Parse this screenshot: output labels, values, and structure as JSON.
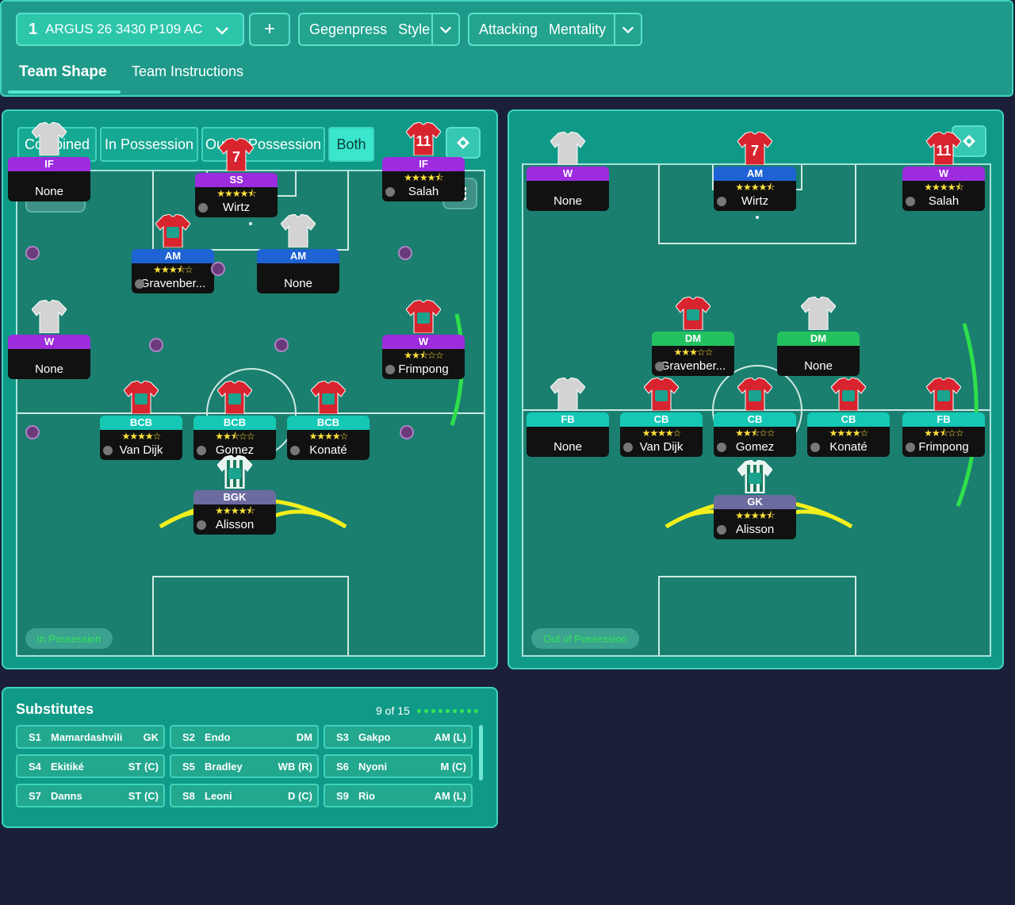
{
  "topbar": {
    "tactic_number": "1",
    "tactic_name": "ARGUS 26 3430 P109 AC",
    "add_label": "+",
    "style_value": "Gegenpress",
    "style_label": "Style",
    "mentality_value": "Attacking",
    "mentality_label": "Mentality",
    "tabs": [
      "Team Shape",
      "Team Instructions"
    ]
  },
  "left_panel": {
    "segments": [
      "Combined",
      "In Possession",
      "Out of Possession",
      "Both"
    ],
    "phase_label": "In Possession",
    "players": [
      {
        "role": "IF",
        "stars": "",
        "name": "None",
        "number": ""
      },
      {
        "role": "SS",
        "stars": "★★★★⯪",
        "name": "Wirtz",
        "number": "7"
      },
      {
        "role": "IF",
        "stars": "★★★★⯪",
        "name": "Salah",
        "number": "11"
      },
      {
        "role": "AM",
        "stars": "★★★⯪☆",
        "name": "Gravenber...",
        "number": ""
      },
      {
        "role": "AM",
        "stars": "",
        "name": "None",
        "number": ""
      },
      {
        "role": "W",
        "stars": "",
        "name": "None",
        "number": ""
      },
      {
        "role": "W",
        "stars": "★★⯪☆☆",
        "name": "Frimpong",
        "number": ""
      },
      {
        "role": "BCB",
        "stars": "★★★★☆",
        "name": "Van Dijk",
        "number": ""
      },
      {
        "role": "BCB",
        "stars": "★★⯪☆☆",
        "name": "Gomez",
        "number": ""
      },
      {
        "role": "BCB",
        "stars": "★★★★☆",
        "name": "Konaté",
        "number": ""
      },
      {
        "role": "BGK",
        "stars": "★★★★⯪",
        "name": "Alisson",
        "number": ""
      }
    ]
  },
  "right_panel": {
    "phase_label": "Out of Possession",
    "players": [
      {
        "role": "W",
        "stars": "",
        "name": "None",
        "number": ""
      },
      {
        "role": "AM",
        "stars": "★★★★⯪",
        "name": "Wirtz",
        "number": "7"
      },
      {
        "role": "W",
        "stars": "★★★★⯪",
        "name": "Salah",
        "number": "11"
      },
      {
        "role": "DM",
        "stars": "★★★☆☆",
        "name": "Gravenber...",
        "number": ""
      },
      {
        "role": "DM",
        "stars": "",
        "name": "None",
        "number": ""
      },
      {
        "role": "FB",
        "stars": "",
        "name": "None",
        "number": ""
      },
      {
        "role": "CB",
        "stars": "★★★★☆",
        "name": "Van Dijk",
        "number": ""
      },
      {
        "role": "CB",
        "stars": "★★⯪☆☆",
        "name": "Gomez",
        "number": ""
      },
      {
        "role": "CB",
        "stars": "★★★★☆",
        "name": "Konaté",
        "number": ""
      },
      {
        "role": "FB",
        "stars": "★★⯪☆☆",
        "name": "Frimpong",
        "number": ""
      },
      {
        "role": "GK",
        "stars": "★★★★⯪",
        "name": "Alisson",
        "number": ""
      }
    ]
  },
  "substitutes": {
    "title": "Substitutes",
    "count": "9 of 15",
    "items": [
      {
        "code": "S1",
        "name": "Mamardashvili",
        "pos": "GK"
      },
      {
        "code": "S2",
        "name": "Endo",
        "pos": "DM"
      },
      {
        "code": "S3",
        "name": "Gakpo",
        "pos": "AM (L)"
      },
      {
        "code": "S4",
        "name": "Ekitiké",
        "pos": "ST (C)"
      },
      {
        "code": "S5",
        "name": "Bradley",
        "pos": "WB (R)"
      },
      {
        "code": "S6",
        "name": "Nyoni",
        "pos": "M (C)"
      },
      {
        "code": "S7",
        "name": "Danns",
        "pos": "ST (C)"
      },
      {
        "code": "S8",
        "name": "Leoni",
        "pos": "D (C)"
      },
      {
        "code": "S9",
        "name": "Rio",
        "pos": "AM (L)"
      }
    ]
  },
  "colors": {
    "accent": "#3ae6cc",
    "panel": "#0f9a87",
    "background": "#1b2038",
    "link_yellow": "#f2ef1c",
    "link_green": "#2fe04a"
  }
}
